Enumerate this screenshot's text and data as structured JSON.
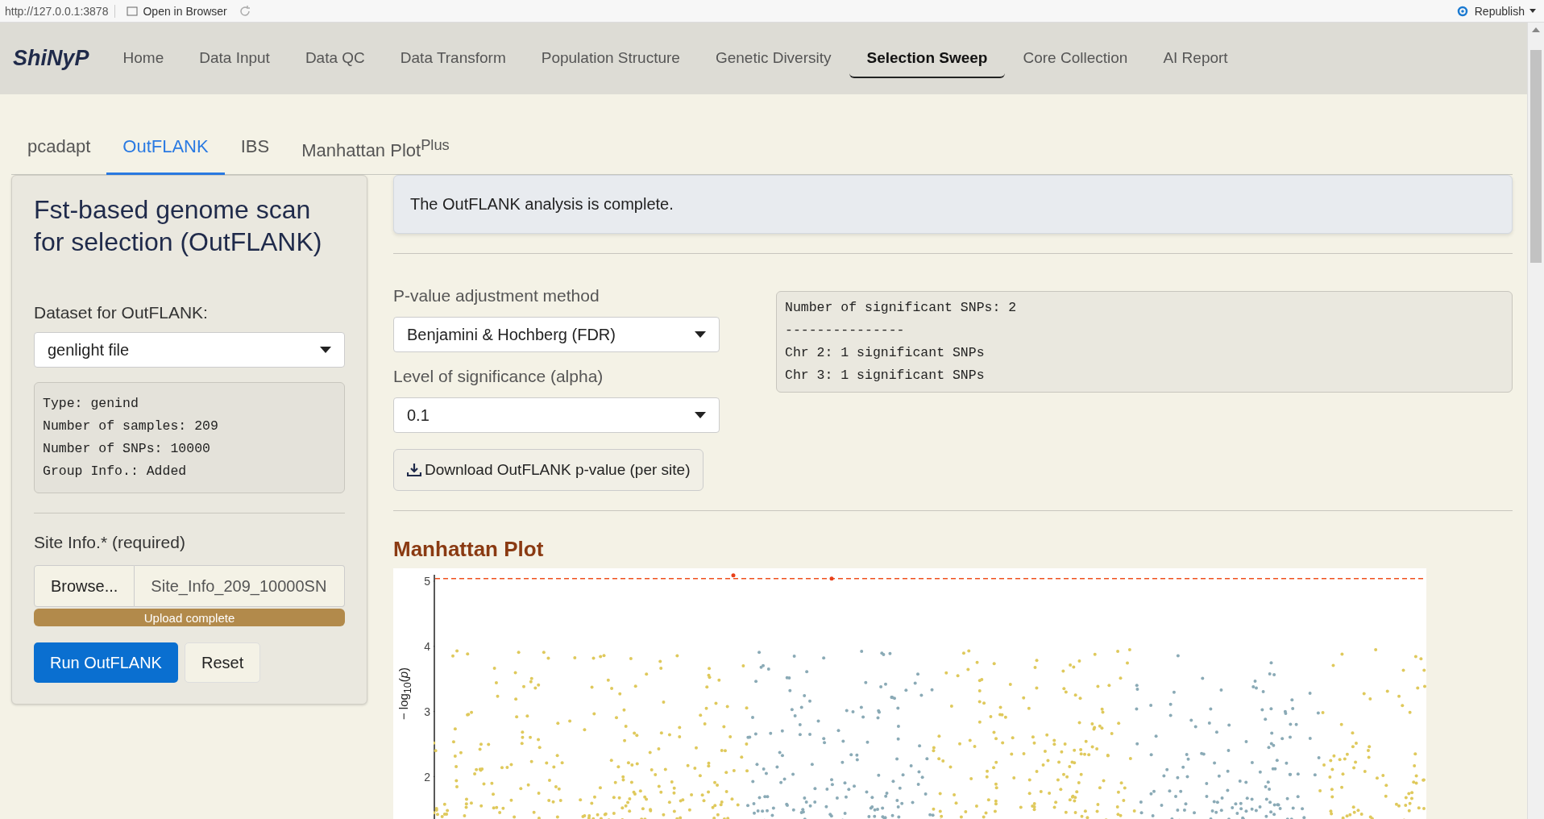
{
  "browser_bar": {
    "url": "http://127.0.0.1:3878",
    "open_button": "Open in Browser",
    "publish_button": "Republish"
  },
  "navbar": {
    "brand": "ShiNyP",
    "items": [
      {
        "label": "Home",
        "selected": false
      },
      {
        "label": "Data Input",
        "selected": false
      },
      {
        "label": "Data QC",
        "selected": false
      },
      {
        "label": "Data Transform",
        "selected": false
      },
      {
        "label": "Population Structure",
        "selected": false
      },
      {
        "label": "Genetic Diversity",
        "selected": false
      },
      {
        "label": "Selection Sweep",
        "selected": true
      },
      {
        "label": "Core Collection",
        "selected": false
      },
      {
        "label": "AI Report",
        "selected": false
      }
    ]
  },
  "subtabs": [
    {
      "label": "pcadapt",
      "selected": false
    },
    {
      "label": "OutFLANK",
      "selected": true
    },
    {
      "label": "IBS",
      "selected": false
    },
    {
      "label": "Manhattan Plot$^{Plus}$",
      "selected": false
    }
  ],
  "sidebar": {
    "title": "Fst-based genome scan for selection (OutFLANK)",
    "dataset_label": "Dataset for OutFLANK:",
    "dataset_value": "genlight file",
    "info_lines": [
      "Type: genind",
      "Number of samples: 209",
      "Number of SNPs: 10000",
      "Group Info.: Added"
    ],
    "site_label": "Site Info.* (required)",
    "browse_button": "Browse...",
    "file_name": "Site_Info_209_10000SN",
    "upload": {
      "text": "Upload complete",
      "level": 1
    },
    "run_button": "Run OutFLANK",
    "reset_button": "Reset"
  },
  "alert": "The OutFLANK analysis is complete.",
  "padjust": {
    "label": "P-value adjustment method",
    "value": "Benjamini & Hochberg (FDR)"
  },
  "alpha": {
    "label": "Level of significance (alpha)",
    "value": "0.1"
  },
  "download_button": "Download OutFLANK p-value (per site)",
  "summary_lines": [
    "Number of significant SNPs: 2",
    "---------------",
    "Chr 2: 1 significant SNPs",
    "Chr 3: 1 significant SNPs"
  ],
  "plot": {
    "title": "Manhattan Plot",
    "ylabel": "− log$_{10}$(*p*)",
    "yticks": [
      "5",
      "4",
      "3",
      "2"
    ]
  }
}
